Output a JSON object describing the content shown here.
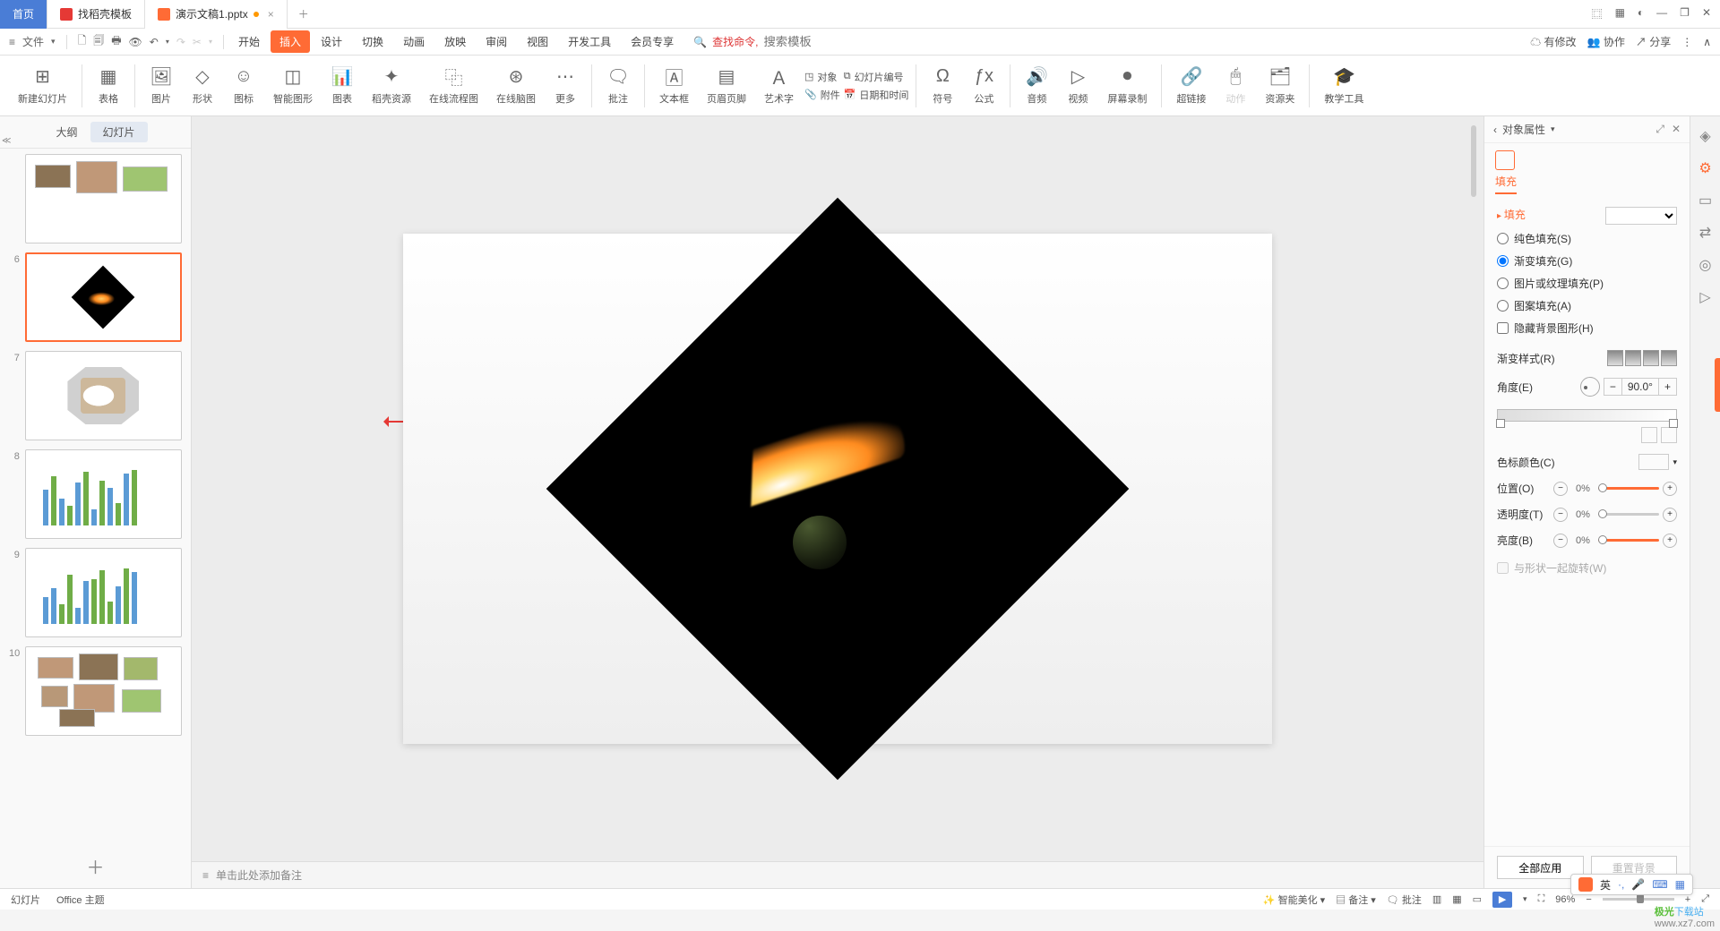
{
  "tabs": {
    "home": "首页",
    "tpl": "找稻壳模板",
    "doc": "演示文稿1.pptx"
  },
  "menu": {
    "file": "文件",
    "items": [
      "开始",
      "插入",
      "设计",
      "切换",
      "动画",
      "放映",
      "审阅",
      "视图",
      "开发工具",
      "会员专享"
    ],
    "searchPrompt": "查找命令,",
    "searchPH": "搜索模板",
    "right": {
      "unsaved": "有修改",
      "coop": "协作",
      "share": "分享"
    }
  },
  "ribbon": {
    "newSlide": "新建幻灯片",
    "table": "表格",
    "image": "图片",
    "shape": "形状",
    "icon": "图标",
    "smart": "智能图形",
    "chart": "图表",
    "docer": "稻壳资源",
    "flow": "在线流程图",
    "mind": "在线脑图",
    "more": "更多",
    "comment": "批注",
    "textbox": "文本框",
    "headfoot": "页眉页脚",
    "wordart": "艺术字",
    "side": {
      "obj": "对象",
      "att": "附件",
      "num": "幻灯片编号",
      "date": "日期和时间"
    },
    "symbol": "符号",
    "formula": "公式",
    "audio": "音频",
    "video": "视频",
    "screen": "屏幕录制",
    "link": "超链接",
    "action": "动作",
    "res": "资源夹",
    "teach": "教学工具"
  },
  "thumbs": {
    "outline": "大纲",
    "slides": "幻灯片",
    "nums": [
      "6",
      "7",
      "8",
      "9",
      "10"
    ]
  },
  "notes": "单击此处添加备注",
  "panel": {
    "title": "对象属性",
    "fillTab": "填充",
    "fillSection": "填充",
    "solid": "纯色填充(S)",
    "grad": "渐变填充(G)",
    "pic": "图片或纹理填充(P)",
    "pattern": "图案填充(A)",
    "hidebg": "隐藏背景图形(H)",
    "gradStyle": "渐变样式(R)",
    "angle": "角度(E)",
    "angleVal": "90.0°",
    "stopColor": "色标颜色(C)",
    "position": "位置(O)",
    "posVal": "0%",
    "trans": "透明度(T)",
    "transVal": "0%",
    "bright": "亮度(B)",
    "brightVal": "0%",
    "rotate": "与形状一起旋转(W)",
    "applyAll": "全部应用",
    "resetBg": "重置背景"
  },
  "status": {
    "slide": "幻灯片",
    "theme": "Office 主题",
    "smart": "智能美化",
    "notes": "备注",
    "comments": "批注",
    "zoom": "96%"
  },
  "ime": {
    "lang": "英"
  },
  "watermark": {
    "a": "极光",
    "b": "下载站",
    "url": "www.xz7.com"
  }
}
